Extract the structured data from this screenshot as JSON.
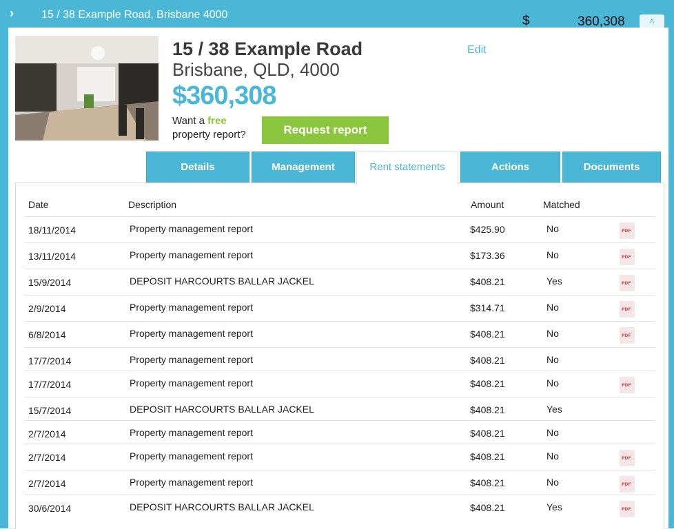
{
  "header": {
    "address": "15 / 38 Example Road, Brisbane 4000",
    "currency": "$",
    "price": "360,308"
  },
  "property": {
    "title_line1": "15 / 38 Example Road",
    "title_line2": "Brisbane, QLD, 4000",
    "price": "$360,308",
    "edit_label": "Edit",
    "promo_pre": "Want a ",
    "promo_free": "free",
    "promo_post": "property report?",
    "request_label": "Request report"
  },
  "tabs": [
    {
      "label": "Details",
      "active": false
    },
    {
      "label": "Management",
      "active": false
    },
    {
      "label": "Rent statements",
      "active": true
    },
    {
      "label": "Actions",
      "active": false
    },
    {
      "label": "Documents",
      "active": false
    }
  ],
  "table": {
    "headers": [
      "Date",
      "Description",
      "Amount",
      "Matched"
    ],
    "rows": [
      {
        "date": "18/11/2014",
        "description": "Property management report",
        "amount": "$425.90",
        "matched": "No",
        "pdf": true
      },
      {
        "date": "13/11/2014",
        "description": "Property management report",
        "amount": "$173.36",
        "matched": "No",
        "pdf": true
      },
      {
        "date": "15/9/2014",
        "description": "DEPOSIT HARCOURTS BALLAR JACKEL",
        "amount": "$408.21",
        "matched": "Yes",
        "pdf": true
      },
      {
        "date": "2/9/2014",
        "description": "Property management report",
        "amount": "$314.71",
        "matched": "No",
        "pdf": true
      },
      {
        "date": "6/8/2014",
        "description": "Property management report",
        "amount": "$408.21",
        "matched": "No",
        "pdf": true
      },
      {
        "date": "17/7/2014",
        "description": "Property management report",
        "amount": "$408.21",
        "matched": "No",
        "pdf": false
      },
      {
        "date": "17/7/2014",
        "description": "Property management report",
        "amount": "$408.21",
        "matched": "No",
        "pdf": true
      },
      {
        "date": "15/7/2014",
        "description": "DEPOSIT HARCOURTS BALLAR JACKEL",
        "amount": "$408.21",
        "matched": "Yes",
        "pdf": false
      },
      {
        "date": "2/7/2014",
        "description": "Property management report",
        "amount": "$408.21",
        "matched": "No",
        "pdf": false
      },
      {
        "date": "2/7/2014",
        "description": "Property management report",
        "amount": "$408.21",
        "matched": "No",
        "pdf": true
      },
      {
        "date": "2/7/2014",
        "description": "Property management report",
        "amount": "$408.21",
        "matched": "No",
        "pdf": true
      },
      {
        "date": "30/6/2014",
        "description": "DEPOSIT HARCOURTS BALLAR JACKEL",
        "amount": "$408.21",
        "matched": "Yes",
        "pdf": true
      }
    ]
  },
  "icons": {
    "expand": "chevron-right-icon",
    "collapse": "chevron-up-icon",
    "pdf": "pdf-file-icon"
  },
  "pdf_icon_text": "PDF",
  "colors": {
    "accent": "#4bb7d6",
    "green": "#8cc63f",
    "pdf_red": "#d84b4b"
  }
}
